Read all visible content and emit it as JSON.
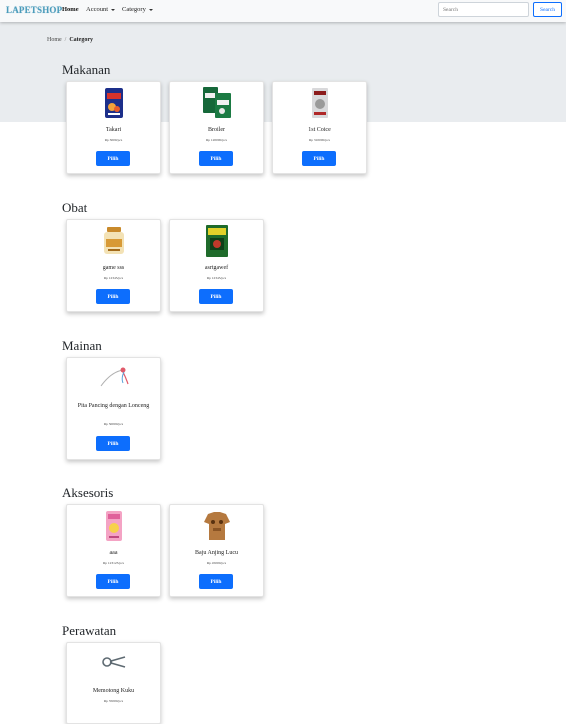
{
  "navbar": {
    "brand": "LAPETSHOP",
    "home": "Home",
    "account": "Account",
    "category": "Category",
    "search_placeholder": "Search",
    "search_button": "Search"
  },
  "breadcrumb": {
    "home": "Home",
    "separator": "/",
    "current": "Category"
  },
  "colors": {
    "primary": "#0d6efd",
    "brand": "#4a9bbb",
    "band": "#e9ecef"
  },
  "sections": [
    {
      "title": "Makanan",
      "products": [
        {
          "name": "Takari",
          "price": "Rp 3000/pcs",
          "button": "Pilih",
          "image": "fish-food-bag"
        },
        {
          "name": "Broiler",
          "price": "Rp 120000/pcs",
          "button": "Pilih",
          "image": "feed-sacks"
        },
        {
          "name": "1st Coice",
          "price": "Rp 310000/pcs",
          "button": "Pilih",
          "image": "pet-food-bag"
        }
      ]
    },
    {
      "title": "Obat",
      "products": [
        {
          "name": "game sss",
          "price": "Rp 12345/pcs",
          "button": "Pilih",
          "image": "medicine-jar"
        },
        {
          "name": "asrtgawef",
          "price": "Rp 12345/pcs",
          "button": "Pilih",
          "image": "medicine-pack"
        }
      ]
    },
    {
      "title": "Mainan",
      "products": [
        {
          "name": "Pita Pancing dengan Lonceng",
          "price": "Rp 50000/pcs",
          "button": "Pilih",
          "image": "fishing-ribbon-toy"
        }
      ]
    },
    {
      "title": "Aksesoris",
      "products": [
        {
          "name": "aaa",
          "price": "Rp 123123/pcs",
          "button": "Pilih",
          "image": "pink-bag"
        },
        {
          "name": "Baju Anjing Lucu",
          "price": "Rp 45000/pcs",
          "button": "Pilih",
          "image": "dog-clothes"
        }
      ]
    },
    {
      "title": "Perawatan",
      "products": [
        {
          "name": "Memotong Kuku",
          "price": "Rp 35000/pcs",
          "button": "Pilih",
          "image": "nail-clipper"
        }
      ]
    }
  ]
}
